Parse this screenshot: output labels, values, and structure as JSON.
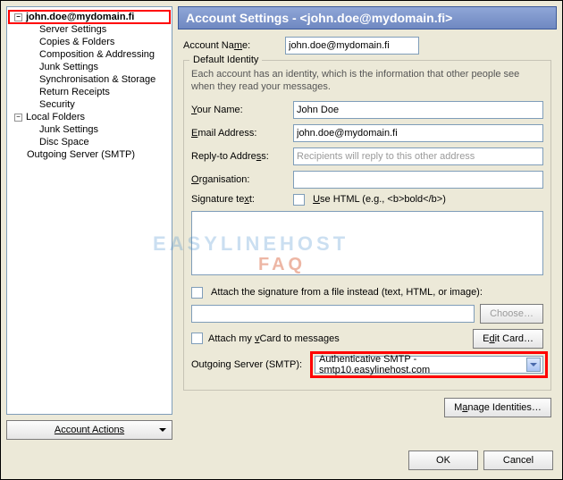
{
  "header": {
    "title": "Account Settings - <john.doe@mydomain.fi>"
  },
  "tree": {
    "account_root": "john.doe@mydomain.fi",
    "account_children": [
      "Server Settings",
      "Copies & Folders",
      "Composition & Addressing",
      "Junk Settings",
      "Synchronisation & Storage",
      "Return Receipts",
      "Security"
    ],
    "local_root": "Local Folders",
    "local_children": [
      "Junk Settings",
      "Disc Space"
    ],
    "outgoing": "Outgoing Server (SMTP)",
    "account_actions": "Account Actions"
  },
  "account_name": {
    "label": "Account Name:",
    "value": "john.doe@mydomain.fi"
  },
  "identity": {
    "legend": "Default Identity",
    "hint": "Each account has an identity, which is the information that other people see when they read your messages.",
    "your_name_label": "Your Name:",
    "your_name_value": "John Doe",
    "email_label": "Email Address:",
    "email_value": "john.doe@mydomain.fi",
    "reply_label": "Reply-to Address:",
    "reply_placeholder": "Recipients will reply to this other address",
    "org_label": "Organisation:",
    "org_value": "",
    "sig_label": "Signature text:",
    "use_html_label": "Use HTML (e.g., <b>bold</b>)",
    "attach_file_label": "Attach the signature from a file instead (text, HTML, or image):",
    "choose_btn": "Choose…",
    "attach_vcard_label": "Attach my vCard to messages",
    "edit_card_btn": "Edit Card…",
    "smtp_label": "Outgoing Server (SMTP):",
    "smtp_value": "Authenticative SMTP - smtp10.easylinehost.com",
    "manage_btn": "Manage Identities…"
  },
  "footer": {
    "ok": "OK",
    "cancel": "Cancel"
  },
  "watermark": {
    "line1": "EASYLINEHOST",
    "line2": "FAQ"
  }
}
